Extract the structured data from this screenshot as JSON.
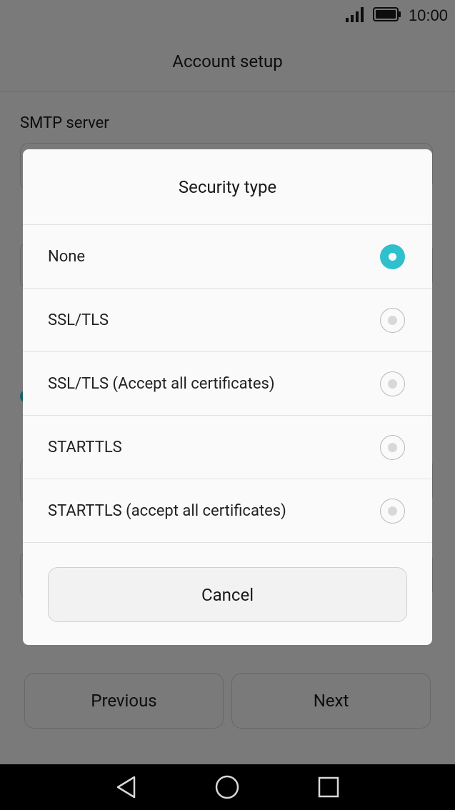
{
  "status_bar": {
    "time": "10:00",
    "icons": [
      "signal-icon",
      "battery-icon"
    ]
  },
  "app_bar": {
    "title": "Account setup"
  },
  "form": {
    "smtp_label": "SMTP server"
  },
  "dialog": {
    "title": "Security type",
    "options": [
      {
        "label": "None",
        "selected": true
      },
      {
        "label": "SSL/TLS",
        "selected": false
      },
      {
        "label": "SSL/TLS (Accept all certificates)",
        "selected": false
      },
      {
        "label": "STARTTLS",
        "selected": false
      },
      {
        "label": "STARTTLS (accept all certificates)",
        "selected": false
      }
    ],
    "cancel_label": "Cancel"
  },
  "footer": {
    "previous_label": "Previous",
    "next_label": "Next"
  },
  "nav_bar": {
    "icons": [
      "back-icon",
      "home-icon",
      "recents-icon"
    ]
  },
  "colors": {
    "accent": "#2ec0cc",
    "scrim": "rgba(0,0,0,0.5)"
  }
}
